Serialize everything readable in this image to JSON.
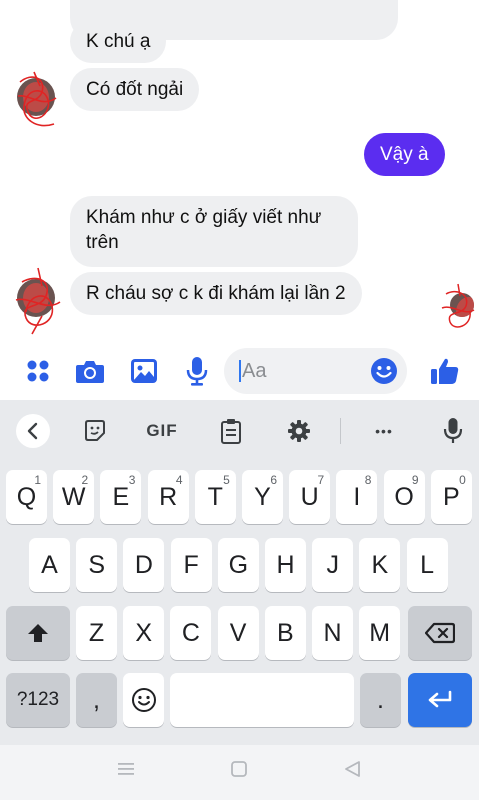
{
  "chat": {
    "messages": [
      {
        "id": "m1",
        "text": "K chú ạ",
        "direction": "incoming"
      },
      {
        "id": "m2",
        "text": "Có đốt ngải",
        "direction": "incoming"
      },
      {
        "id": "m3",
        "text": "Vậy à",
        "direction": "outgoing"
      },
      {
        "id": "m4",
        "text": "Khám như c ở giấy viết như trên",
        "direction": "incoming"
      },
      {
        "id": "m5",
        "text": "R cháu sợ c k đi khám lại lần 2",
        "direction": "incoming"
      }
    ],
    "outgoing_color": "#5b2df0",
    "incoming_color": "#eeeff1"
  },
  "composer": {
    "placeholder": "Aa",
    "icons": [
      "apps-icon",
      "camera-icon",
      "gallery-icon",
      "mic-icon",
      "emoji-icon",
      "thumbs-up-icon"
    ],
    "accent_color": "#2c5fe6"
  },
  "keyboard": {
    "toolbar": {
      "icons": [
        "back-icon",
        "sticker-icon",
        "gif-icon",
        "clipboard-icon",
        "settings-icon",
        "more-icon",
        "mic-icon"
      ],
      "gif_label": "GIF",
      "more_label": "•••"
    },
    "row1": [
      {
        "k": "Q",
        "n": "1"
      },
      {
        "k": "W",
        "n": "2"
      },
      {
        "k": "E",
        "n": "3"
      },
      {
        "k": "R",
        "n": "4"
      },
      {
        "k": "T",
        "n": "5"
      },
      {
        "k": "Y",
        "n": "6"
      },
      {
        "k": "U",
        "n": "7"
      },
      {
        "k": "I",
        "n": "8"
      },
      {
        "k": "O",
        "n": "9"
      },
      {
        "k": "P",
        "n": "0"
      }
    ],
    "row2": [
      "A",
      "S",
      "D",
      "F",
      "G",
      "H",
      "J",
      "K",
      "L"
    ],
    "row3": [
      "Z",
      "X",
      "C",
      "V",
      "B",
      "N",
      "M"
    ],
    "symbols_label": "?123",
    "comma_label": ",",
    "period_label": ".",
    "enter_color": "#2f74e6"
  },
  "navbar": {
    "icons": [
      "recents-icon",
      "home-icon",
      "back-nav-icon"
    ]
  }
}
